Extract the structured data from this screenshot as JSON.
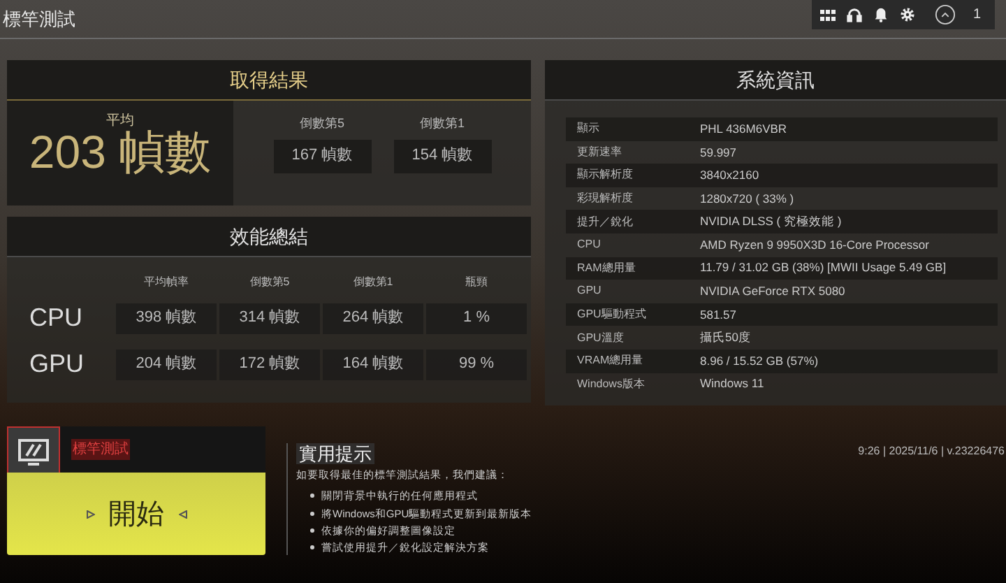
{
  "title": "標竿測試",
  "toolbar": {
    "notification_count": "1"
  },
  "results": {
    "title": "取得結果",
    "average": {
      "label": "平均",
      "value": "203 幀數"
    },
    "lows": [
      {
        "label": "倒數第5",
        "value": "167 幀數"
      },
      {
        "label": "倒數第1",
        "value": "154 幀數"
      }
    ]
  },
  "performance": {
    "title": "效能總結",
    "columns": [
      "平均幀率",
      "倒數第5",
      "倒數第1",
      "瓶頸"
    ],
    "rows": [
      {
        "name": "CPU",
        "cells": [
          "398 幀數",
          "314 幀數",
          "264 幀數",
          "1 %"
        ]
      },
      {
        "name": "GPU",
        "cells": [
          "204 幀數",
          "172 幀數",
          "164 幀數",
          "99 %"
        ]
      }
    ]
  },
  "system": {
    "title": "系統資訊",
    "rows": [
      {
        "label": "顯示",
        "value": "PHL 436M6VBR"
      },
      {
        "label": "更新速率",
        "value": "59.997"
      },
      {
        "label": "顯示解析度",
        "value": "3840x2160"
      },
      {
        "label": "彩現解析度",
        "value": "1280x720 ( 33% )"
      },
      {
        "label": "提升／銳化",
        "value": "NVIDIA DLSS ( 究極效能 )"
      },
      {
        "label": "CPU",
        "value": "AMD Ryzen 9 9950X3D 16-Core Processor"
      },
      {
        "label": "RAM總用量",
        "value": "11.79 / 31.02 GB (38%) [MWII Usage 5.49 GB]"
      },
      {
        "label": "GPU",
        "value": "NVIDIA GeForce RTX 5080"
      },
      {
        "label": "GPU驅動程式",
        "value": "581.57"
      },
      {
        "label": "GPU溫度",
        "value": "攝氏50度"
      },
      {
        "label": "VRAM總用量",
        "value": "8.96 / 15.52 GB (57%)"
      },
      {
        "label": "Windows版本",
        "value": "Windows 11"
      }
    ]
  },
  "benchmark": {
    "label": "標竿測試",
    "button": "開始"
  },
  "tips": {
    "title": "實用提示",
    "intro": "如要取得最佳的標竿測試結果，我們建議：",
    "items": [
      "關閉背景中執行的任何應用程式",
      "將Windows和GPU驅動程式更新到最新版本",
      "依據你的偏好調整圖像設定",
      "嘗試使用提升／銳化設定解決方案"
    ]
  },
  "status": "9:26 | 2025/11/6 | v.23226476"
}
